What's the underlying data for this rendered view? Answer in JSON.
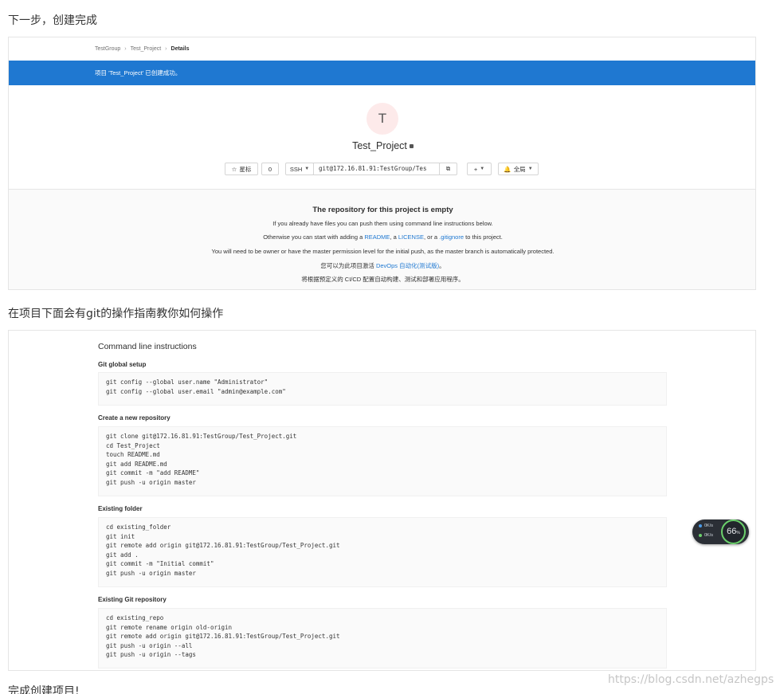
{
  "blog": {
    "text1": "下一步，创建完成",
    "text2": "在项目下面会有git的操作指南教你如何操作",
    "text3": "完成创建项目!",
    "watermark": "https://blog.csdn.net/azhegps"
  },
  "breadcrumb": {
    "items": [
      "TestGroup",
      "Test_Project",
      "Details"
    ]
  },
  "flash": {
    "message": "项目 'Test_Project' 已创建成功。",
    "color": "#1f78d1"
  },
  "project": {
    "avatar_letter": "T",
    "name": "Test_Project",
    "star_label": "星标",
    "star_count": "0",
    "protocol": "SSH",
    "clone_url": "git@172.16.81.91:TestGroup/Tes",
    "plus_label": "+",
    "notification_label": "全局"
  },
  "empty_repo": {
    "title": "The repository for this project is empty",
    "line1": "If you already have files you can push them using command line instructions below.",
    "line2_prefix": "Otherwise you can start with adding a ",
    "line2_readme": "README",
    "line2_sep1": ", a ",
    "line2_license": "LICENSE",
    "line2_sep2": ", or a ",
    "line2_gitignore": ".gitignore",
    "line2_suffix": " to this project.",
    "line3": "You will need to be owner or have the master permission level for the initial push, as the master branch is automatically protected.",
    "line4_prefix": "您可以为此项目激活 ",
    "line4_link": "DevOps 自动化(测试版)",
    "line4_suffix": "。",
    "line5": "将根据预定义的 CI/CD 配置自动构建、测试和部署应用程序。"
  },
  "cli": {
    "title": "Command line instructions",
    "sections": [
      {
        "title": "Git global setup",
        "lines": [
          "git config --global user.name \"Administrator\"",
          "git config --global user.email \"admin@example.com\""
        ]
      },
      {
        "title": "Create a new repository",
        "lines": [
          "git clone git@172.16.81.91:TestGroup/Test_Project.git",
          "cd Test_Project",
          "touch README.md",
          "git add README.md",
          "git commit -m \"add README\"",
          "git push -u origin master"
        ]
      },
      {
        "title": "Existing folder",
        "lines": [
          "cd existing_folder",
          "git init",
          "git remote add origin git@172.16.81.91:TestGroup/Test_Project.git",
          "git add .",
          "git commit -m \"Initial commit\"",
          "git push -u origin master"
        ]
      },
      {
        "title": "Existing Git repository",
        "lines": [
          "cd existing_repo",
          "git remote rename origin old-origin",
          "git remote add origin git@172.16.81.91:TestGroup/Test_Project.git",
          "git push -u origin --all",
          "git push -u origin --tags"
        ]
      }
    ]
  },
  "speed_widget": {
    "up": "0K/s",
    "down": "0K/s",
    "percent": "66",
    "percent_unit": "%",
    "accent": "#6bd06b"
  }
}
